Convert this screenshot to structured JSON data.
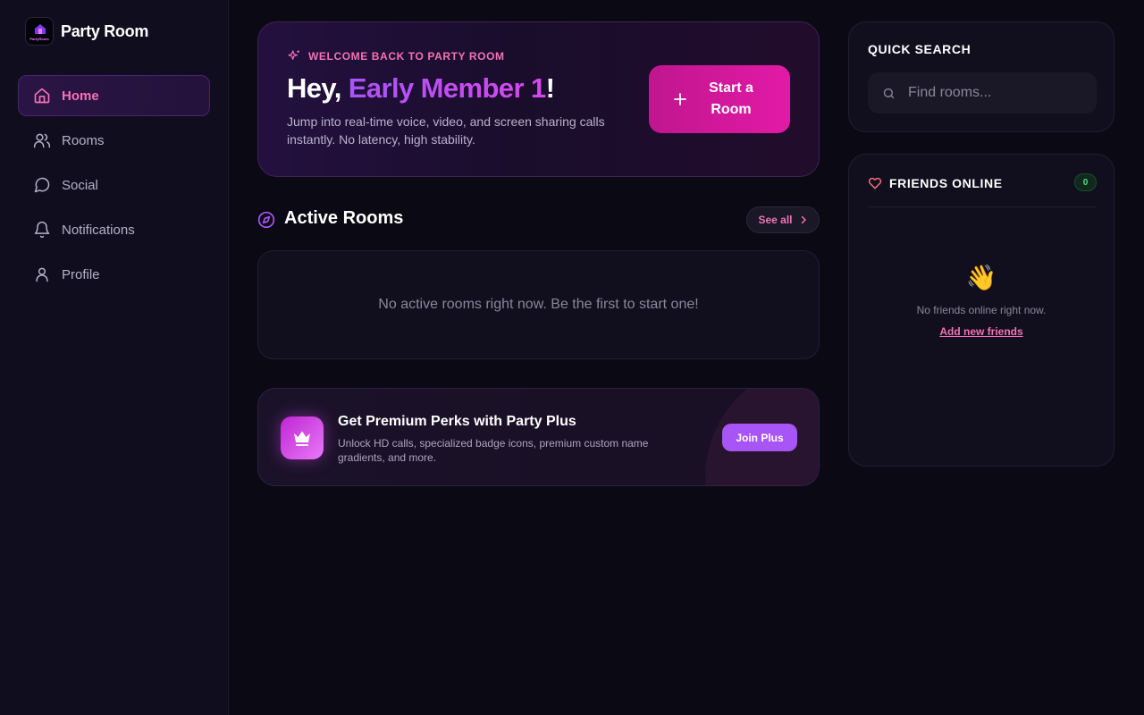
{
  "brand": {
    "name": "Party Room",
    "logo_text": "PartyRoom"
  },
  "sidebar": {
    "items": [
      {
        "label": "Home",
        "icon": "home-icon",
        "active": true
      },
      {
        "label": "Rooms",
        "icon": "users-icon"
      },
      {
        "label": "Social",
        "icon": "chat-bubble-icon"
      },
      {
        "label": "Notifications",
        "icon": "bell-icon"
      },
      {
        "label": "Profile",
        "icon": "user-icon"
      }
    ]
  },
  "hero": {
    "kicker": "WELCOME BACK TO PARTY ROOM",
    "greeting": "Hey, ",
    "name": "Early Member 1",
    "exclaim": "!",
    "description": "Jump into real-time voice, video, and screen sharing calls instantly. No latency, high stability.",
    "start_button": "Start a Room"
  },
  "active_rooms": {
    "title": "Active Rooms",
    "see_all": "See all",
    "empty_text": "No active rooms right now. Be the first to start one!"
  },
  "premium": {
    "title": "Get Premium Perks with Party Plus",
    "description": "Unlock HD calls, specialized badge icons, premium custom name gradients, and more.",
    "button": "Join Plus"
  },
  "quick_search": {
    "title": "QUICK SEARCH",
    "placeholder": "Find rooms..."
  },
  "friends": {
    "title": "FRIENDS ONLINE",
    "count": "0",
    "emoji": "👋",
    "empty_text": "No friends online right now.",
    "add_link": "Add new friends"
  },
  "colors": {
    "accent_pink": "#f472b6",
    "accent_purple": "#a855f7",
    "background": "#0b0a14",
    "online_green": "#4ade80"
  }
}
